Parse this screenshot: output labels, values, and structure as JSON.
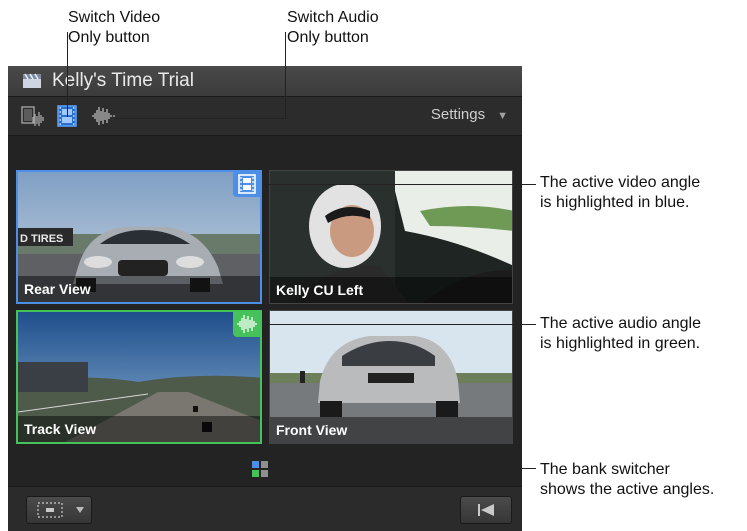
{
  "callouts": {
    "switch_video": [
      "Switch Video",
      "Only button"
    ],
    "switch_audio": [
      "Switch Audio",
      "Only button"
    ],
    "active_video": [
      "The active video angle",
      "is highlighted in blue."
    ],
    "active_audio": [
      "The active audio angle",
      "is highlighted in green."
    ],
    "bank_switcher": [
      "The bank switcher",
      "shows the active angles."
    ]
  },
  "viewer": {
    "title": "Kelly's Time Trial",
    "settings_label": "Settings",
    "settings_arrow": "▼"
  },
  "angles": [
    {
      "label": "Rear View",
      "state": "video-active"
    },
    {
      "label": "Kelly CU Left",
      "state": "none"
    },
    {
      "label": "Track View",
      "state": "audio-active"
    },
    {
      "label": "Front View",
      "state": "none"
    }
  ],
  "colors": {
    "video_active": "#4d8fe6",
    "audio_active": "#45c25a"
  },
  "icons": {
    "title": "clapperboard-icon",
    "toolbar": [
      "switch-video-audio-icon",
      "switch-video-only-icon",
      "switch-audio-only-icon"
    ],
    "badges": [
      "filmstrip-icon",
      "waveform-icon"
    ],
    "bottom": [
      "overlay-icon",
      "chevron-down-icon",
      "skip-back-icon"
    ]
  }
}
